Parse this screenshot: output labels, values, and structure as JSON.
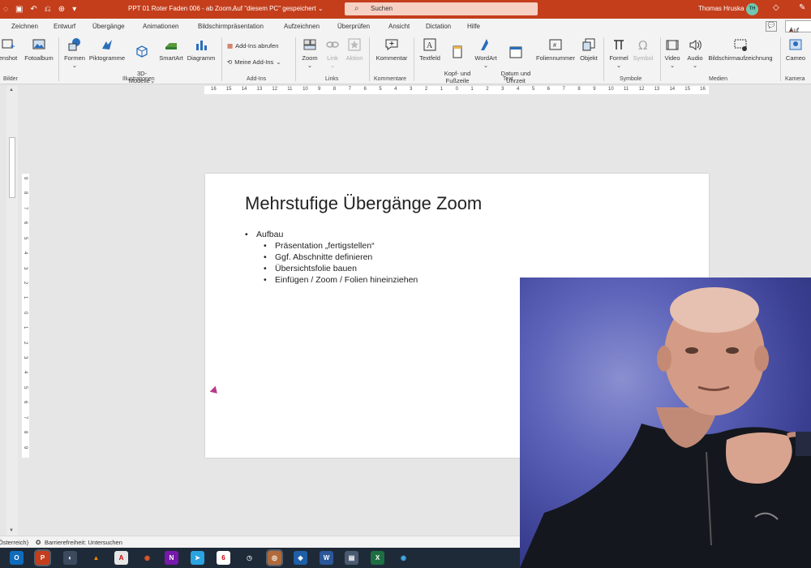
{
  "titlebar": {
    "doc_title": "PPT 01 Roter Faden 006 - ab Zoom...",
    "save_state": "Auf \"diesem PC\" gespeichert",
    "save_caret": "⌄",
    "search_placeholder": "Suchen",
    "user_name": "Thomas Hruska",
    "user_initials": "TH"
  },
  "tabs": [
    "Zeichnen",
    "Entwurf",
    "Übergänge",
    "Animationen",
    "Bildschirmpräsentation",
    "Aufzeichnen",
    "Überprüfen",
    "Ansicht",
    "Dictation",
    "Hilfe"
  ],
  "record_label": "Auf",
  "ribbon": {
    "bilder": {
      "screenshot": "enshot",
      "fotoalbum": "Fotoalbum",
      "group": "Bilder"
    },
    "illustrationen": {
      "formen": "Formen",
      "piktogramme": "Piktogramme",
      "modelle": "3D-\nModelle",
      "smartart": "SmartArt",
      "diagramm": "Diagramm",
      "group": "Illustrationen"
    },
    "addins": {
      "abrufen": "Add-Ins abrufen",
      "meine": "Meine Add-Ins",
      "group": "Add-Ins"
    },
    "links": {
      "zoom": "Zoom",
      "link": "Link",
      "aktion": "Aktion",
      "group": "Links"
    },
    "kommentare": {
      "kommentar": "Kommentar",
      "group": "Kommentare"
    },
    "text": {
      "textfeld": "Textfeld",
      "kopf": "Kopf- und\nFußzeile",
      "wordart": "WordArt",
      "datum": "Datum und\nUhrzeit",
      "folien": "Foliennummer",
      "objekt": "Objekt",
      "group": "Text"
    },
    "symbole": {
      "formel": "Formel",
      "symbol": "Symbol",
      "group": "Symbole"
    },
    "medien": {
      "video": "Video",
      "audio": "Audio",
      "bildschirm": "Bildschirmaufzeichnung",
      "group": "Medien"
    },
    "kamera": {
      "cameo": "Cameo",
      "group": "Kamera"
    }
  },
  "ruler_labels": [
    "16",
    "15",
    "14",
    "13",
    "12",
    "11",
    "10",
    "9",
    "8",
    "7",
    "6",
    "5",
    "4",
    "3",
    "2",
    "1",
    "0",
    "1",
    "2",
    "3",
    "4",
    "5",
    "6",
    "7",
    "8",
    "9",
    "10",
    "11",
    "12",
    "13",
    "14",
    "15",
    "16"
  ],
  "vruler_labels": [
    "9",
    "8",
    "7",
    "6",
    "5",
    "4",
    "3",
    "2",
    "1",
    "0",
    "1",
    "2",
    "3",
    "4",
    "5",
    "6",
    "7",
    "8",
    "9"
  ],
  "slide": {
    "title": "Mehrstufige Übergänge Zoom",
    "bullets": [
      {
        "level": 1,
        "text": "Aufbau"
      },
      {
        "level": 2,
        "text": "Präsentation „fertigstellen“"
      },
      {
        "level": 2,
        "text": "Ggf. Abschnitte definieren"
      },
      {
        "level": 2,
        "text": "Übersichtsfolie bauen"
      },
      {
        "level": 2,
        "text": "Einfügen / Zoom / Folien hineinziehen"
      }
    ]
  },
  "statusbar": {
    "language": "Österreich)",
    "accessibility": "Barrierefreiheit: Untersuchen"
  },
  "taskbar_icons": [
    "outlook",
    "powerpoint",
    "app",
    "vlc",
    "acrobat",
    "onenote",
    "telegram",
    "app",
    "app",
    "app",
    "app",
    "app",
    "word",
    "app",
    "excel",
    "edge"
  ],
  "colors": {
    "accent": "#c43e1c",
    "taskbar": "#1f2a38"
  }
}
